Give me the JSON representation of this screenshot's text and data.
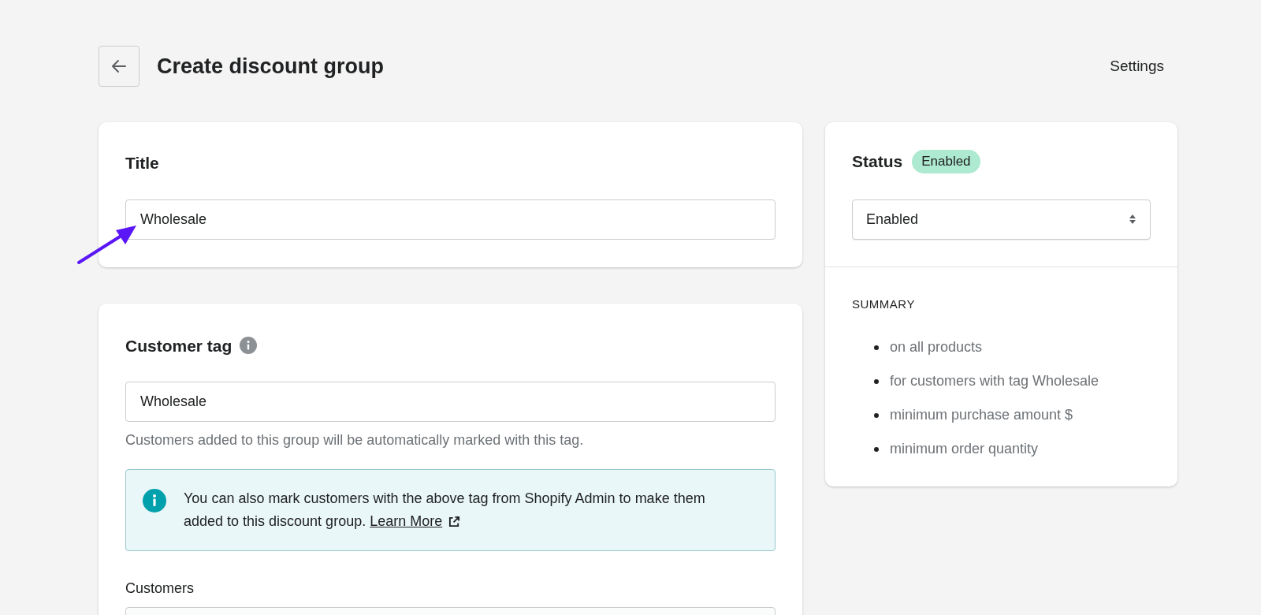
{
  "header": {
    "title": "Create discount group",
    "settings_link": "Settings"
  },
  "title_card": {
    "heading": "Title",
    "value": "Wholesale"
  },
  "customer_tag_card": {
    "heading": "Customer tag",
    "value": "Wholesale",
    "help": "Customers added to this group will be automatically marked with this tag.",
    "notice": {
      "text": "You can also mark customers with the above tag from Shopify Admin to make them added to this discount group.",
      "link": "Learn More"
    },
    "customers_label": "Customers"
  },
  "status_card": {
    "heading": "Status",
    "badge": "Enabled",
    "select_value": "Enabled",
    "summary_heading": "SUMMARY",
    "summary_items": [
      "on all products",
      "for customers with tag Wholesale",
      "minimum purchase amount $",
      "minimum order quantity"
    ]
  },
  "annotation": {
    "arrow": true
  }
}
